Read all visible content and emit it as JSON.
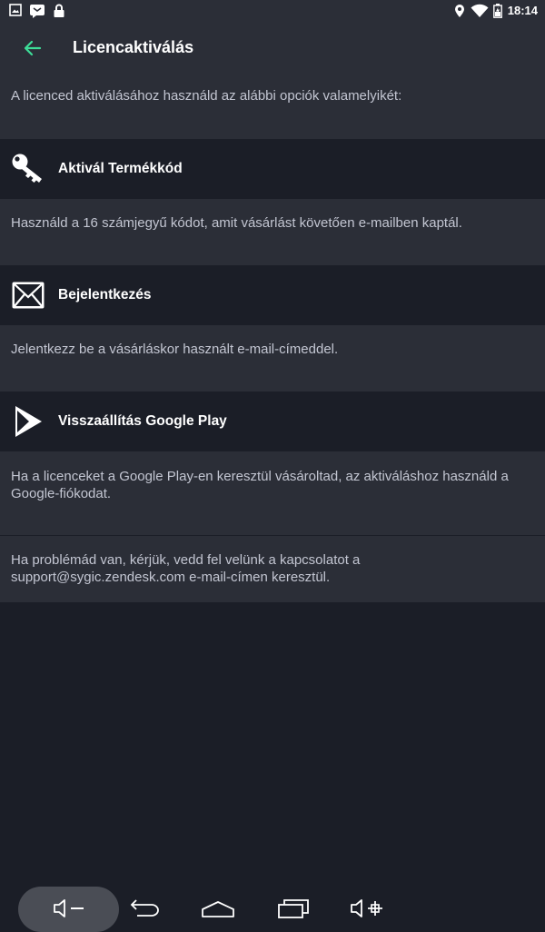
{
  "status_bar": {
    "time": "18:14",
    "left_icons": [
      "image-icon",
      "message-icon",
      "lock-icon"
    ],
    "right_icons": [
      "location-icon",
      "wifi-icon",
      "battery-icon"
    ]
  },
  "app_bar": {
    "title": "Licencaktiválás",
    "back_icon": "arrow-left-icon",
    "accent_color": "#3ddc97"
  },
  "intro_text": "A licenced aktiválásához használd az alábbi opciók valamelyikét:",
  "options": [
    {
      "icon": "key-icon",
      "label": "Aktivál Termékkód",
      "description": "Használd a 16 számjegyű kódot, amit vásárlást követően e-mailben kaptál."
    },
    {
      "icon": "envelope-icon",
      "label": "Bejelentkezés",
      "description": "Jelentkezz be a vásárláskor használt e-mail-címeddel."
    },
    {
      "icon": "google-play-icon",
      "label": "Visszaállítás Google Play",
      "description": "Ha a licenceket a Google Play-en keresztül vásároltad, az aktiváláshoz használd a Google-fiókodat."
    }
  ],
  "support_text": "Ha problémád van, kérjük, vedd fel velünk a kapcsolatot a support@sygic.zendesk.com e-mail-címen keresztül.",
  "nav_bar": {
    "buttons": [
      "volume-down-icon",
      "back-icon",
      "home-icon",
      "recents-icon",
      "volume-up-icon"
    ]
  },
  "colors": {
    "background": "#1b1e27",
    "panel": "#2b2e37",
    "text_secondary": "#c3c6d2",
    "text_primary": "#ffffff"
  }
}
